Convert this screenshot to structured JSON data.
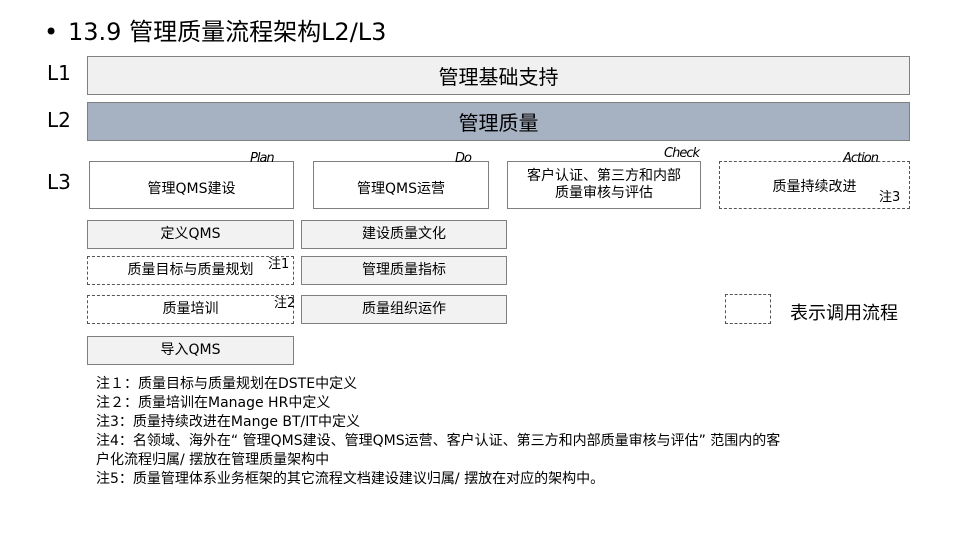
{
  "title": {
    "bullet": "•",
    "text": "13.9  管理质量流程架构L2/L3"
  },
  "levels": {
    "l1": "L1",
    "l2": "L2",
    "l3": "L3"
  },
  "l1_band": "管理基础支持",
  "l2_band": "管理质量",
  "l3": [
    {
      "label": "管理QMS建设",
      "pdca": "Plan"
    },
    {
      "label": "管理QMS运营",
      "pdca": "Do"
    },
    {
      "label": "客户认证、第三方和内部质量审核与评估",
      "pdca": "Check"
    },
    {
      "label": "质量持续改进",
      "pdca": "Action",
      "note": "注3"
    }
  ],
  "col1": [
    {
      "label": "定义QMS"
    },
    {
      "label": "质量目标与质量规划",
      "note": "注1"
    },
    {
      "label": "质量培训",
      "note": "注2"
    },
    {
      "label": "导入QMS"
    }
  ],
  "col2": [
    {
      "label": "建设质量文化"
    },
    {
      "label": "管理质量指标"
    },
    {
      "label": "质量组织运作"
    }
  ],
  "legend": {
    "label": "表示调用流程"
  },
  "notes": [
    "注１：质量目标与质量规划在DSTE中定义",
    "注２：质量培训在Manage HR中定义",
    "注3：质量持续改进在Mange BT/IT中定义",
    "注4：名领域、海外在“ 管理QMS建设、管理QMS运营、客户认证、第三方和内部质量审核与评估” 范围内的客",
    "户化流程归属/ 摆放在管理质量架构中",
    "注5：质量管理体系业务框架的其它流程文档建设建议归属/ 摆放在对应的架构中。"
  ]
}
